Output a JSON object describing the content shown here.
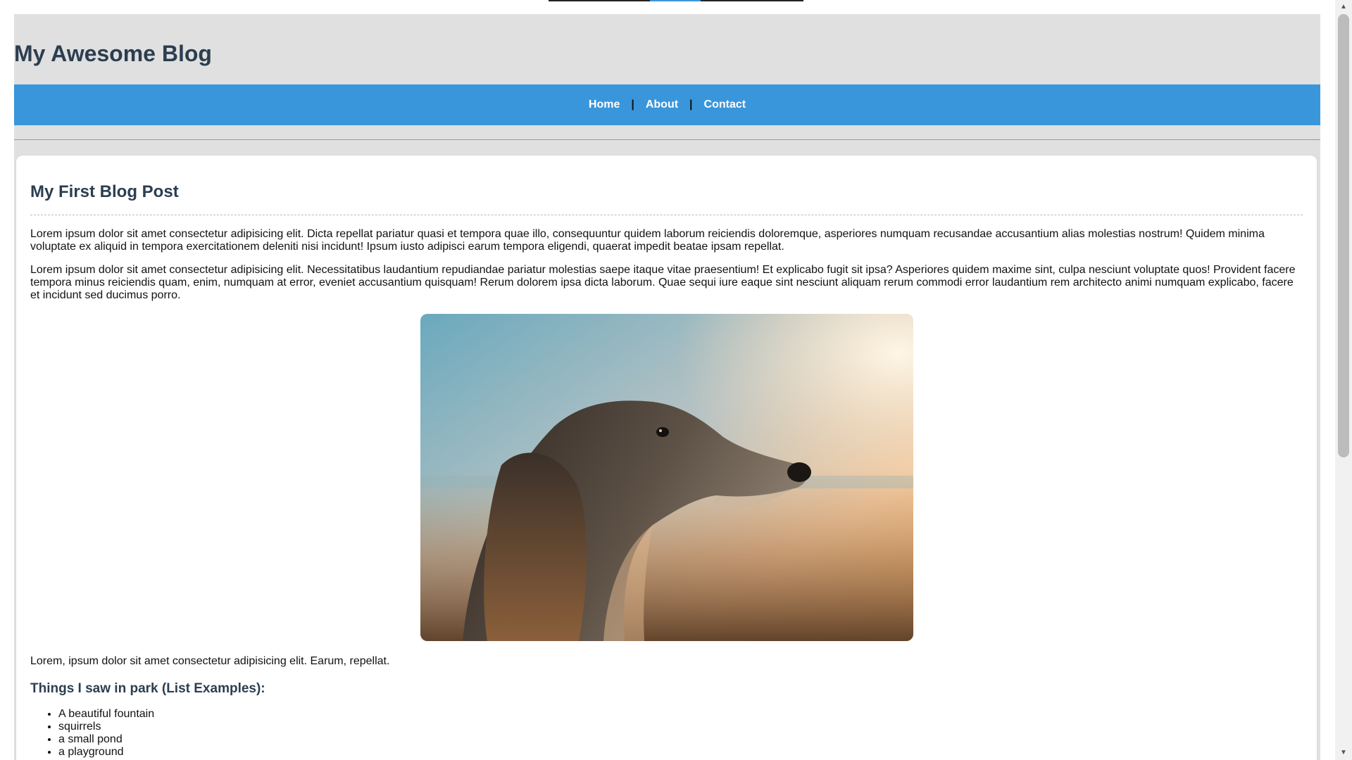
{
  "header": {
    "site_title": "My Awesome Blog"
  },
  "nav": {
    "links": [
      "Home",
      "About",
      "Contact"
    ],
    "separator": "|"
  },
  "post": {
    "title": "My First Blog Post",
    "paragraphs": [
      "Lorem ipsum dolor sit amet consectetur adipisicing elit. Dicta repellat pariatur quasi et tempora quae illo, consequuntur quidem laborum reiciendis doloremque, asperiores numquam recusandae accusantium alias molestias nostrum! Quidem minima voluptate ex aliquid in tempora exercitationem deleniti nisi incidunt! Ipsum iusto adipisci earum tempora eligendi, quaerat impedit beatae ipsam repellat.",
      "Lorem ipsum dolor sit amet consectetur adipisicing elit. Necessitatibus laudantium repudiandae pariatur molestias saepe itaque vitae praesentium! Et explicabo fugit sit ipsa? Asperiores quidem maxime sint, culpa nesciunt voluptate quos! Provident facere tempora minus reiciendis quam, enim, numquam at error, eveniet accusantium quisquam! Rerum dolorem ipsa dicta laborum. Quae sequi iure eaque sint nesciunt aliquam rerum commodi error laudantium rem architecto animi numquam explicabo, facere et incidunt sed ducimus porro."
    ],
    "image": {
      "subject": "dog-portrait-at-sunset"
    },
    "caption": "Lorem, ipsum dolor sit amet consectetur adipisicing elit. Earum, repellat.",
    "list_heading": "Things I saw in park (List Examples):",
    "list_items": [
      "A beautiful fountain",
      "squirrels",
      "a small pond",
      "a playground"
    ]
  },
  "colors": {
    "nav_bg": "#3a96db",
    "title_color": "#2c3e50",
    "page_bg": "#e0e0e0"
  },
  "scrollbar": {
    "up_icon": "scroll-up-arrow-icon",
    "down_icon": "scroll-down-arrow-icon",
    "up_glyph": "▲",
    "down_glyph": "▼"
  }
}
